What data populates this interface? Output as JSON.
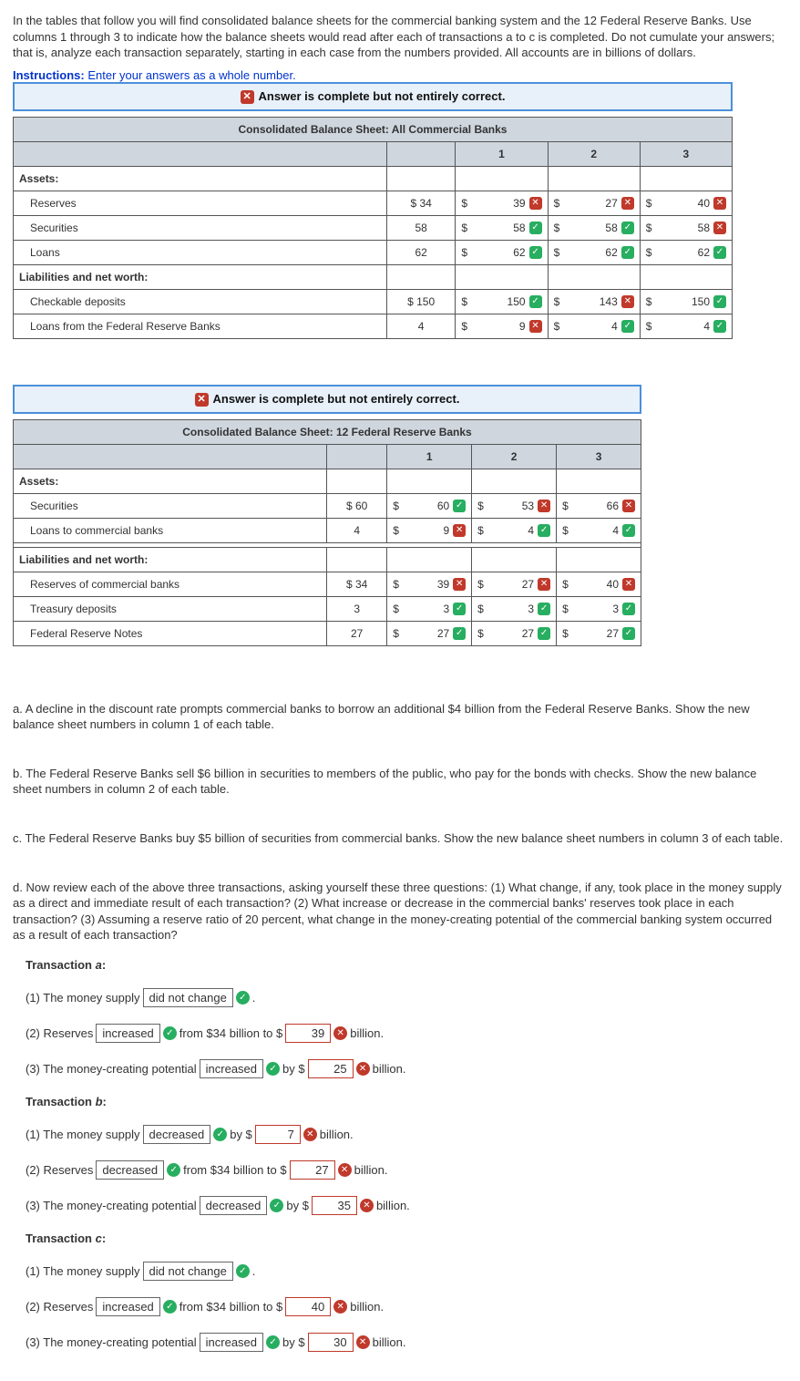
{
  "intro": "In the tables that follow you will find consolidated balance sheets for the commercial banking system and the 12 Federal Reserve Banks. Use columns 1 through 3 to indicate how the balance sheets would read after each of transactions a to c is completed. Do not cumulate your answers; that is, analyze each transaction separately, starting in each case from the numbers provided. All accounts are in billions of dollars.",
  "instructions_label": "Instructions:",
  "instructions_text": " Enter your answers as a whole number.",
  "banner_text": "Answer is complete but not entirely correct.",
  "col": {
    "c1": "1",
    "c2": "2",
    "c3": "3"
  },
  "t1": {
    "title": "Consolidated Balance Sheet: All Commercial Banks",
    "assets_label": "Assets:",
    "liab_label": "Liabilities and net worth:",
    "rows": {
      "reserves": {
        "label": "Reserves",
        "base": "$ 34",
        "c1": {
          "v": "39",
          "ok": false
        },
        "c2": {
          "v": "27",
          "ok": false
        },
        "c3": {
          "v": "40",
          "ok": false
        }
      },
      "securities": {
        "label": "Securities",
        "base": "58",
        "c1": {
          "v": "58",
          "ok": true
        },
        "c2": {
          "v": "58",
          "ok": true
        },
        "c3": {
          "v": "58",
          "ok": false
        }
      },
      "loans": {
        "label": "Loans",
        "base": "62",
        "c1": {
          "v": "62",
          "ok": true
        },
        "c2": {
          "v": "62",
          "ok": true
        },
        "c3": {
          "v": "62",
          "ok": true
        }
      },
      "deposits": {
        "label": "Checkable deposits",
        "base": "$ 150",
        "c1": {
          "v": "150",
          "ok": true
        },
        "c2": {
          "v": "143",
          "ok": false
        },
        "c3": {
          "v": "150",
          "ok": true
        }
      },
      "frb_loans": {
        "label": "Loans from the Federal Reserve Banks",
        "base": "4",
        "c1": {
          "v": "9",
          "ok": false
        },
        "c2": {
          "v": "4",
          "ok": true
        },
        "c3": {
          "v": "4",
          "ok": true
        }
      }
    }
  },
  "t2": {
    "title": "Consolidated Balance Sheet: 12 Federal Reserve Banks",
    "assets_label": "Assets:",
    "liab_label": "Liabilities and net worth:",
    "rows": {
      "securities": {
        "label": "Securities",
        "base": "$ 60",
        "c1": {
          "v": "60",
          "ok": true
        },
        "c2": {
          "v": "53",
          "ok": false
        },
        "c3": {
          "v": "66",
          "ok": false
        }
      },
      "loans_cb": {
        "label": "Loans to commercial banks",
        "base": "4",
        "c1": {
          "v": "9",
          "ok": false
        },
        "c2": {
          "v": "4",
          "ok": true
        },
        "c3": {
          "v": "4",
          "ok": true
        }
      },
      "reserves_cb": {
        "label": "Reserves of commercial banks",
        "base": "$ 34",
        "c1": {
          "v": "39",
          "ok": false
        },
        "c2": {
          "v": "27",
          "ok": false
        },
        "c3": {
          "v": "40",
          "ok": false
        }
      },
      "treasury": {
        "label": "Treasury deposits",
        "base": "3",
        "c1": {
          "v": "3",
          "ok": true
        },
        "c2": {
          "v": "3",
          "ok": true
        },
        "c3": {
          "v": "3",
          "ok": true
        }
      },
      "frn": {
        "label": "Federal Reserve Notes",
        "base": "27",
        "c1": {
          "v": "27",
          "ok": true
        },
        "c2": {
          "v": "27",
          "ok": true
        },
        "c3": {
          "v": "27",
          "ok": true
        }
      }
    }
  },
  "qa": "a. A decline in the discount rate prompts commercial banks to borrow an additional $4 billion from the Federal Reserve Banks. Show the new balance sheet numbers in column 1 of each table.",
  "qb": "b. The Federal Reserve Banks sell $6 billion in securities to members of the public, who pay for the bonds with checks. Show the new balance sheet numbers in column 2 of each table.",
  "qc": "c. The Federal Reserve Banks buy $5 billion of securities from commercial banks. Show the new balance sheet numbers in column 3 of each table.",
  "qd": "d. Now review each of the above three transactions, asking yourself these three questions: (1) What change, if any, took place in the money supply as a direct and immediate result of each transaction? (2) What increase or decrease in the commercial banks' reserves took place in each transaction? (3) Assuming a reserve ratio of 20 percent, what change in the money-creating potential of the commercial banking system occurred as a result of each transaction?",
  "ans": {
    "ta_label": "Transaction a:",
    "tb_label": "Transaction b:",
    "tc_label": "Transaction c:",
    "a1_pre": "(1) The money supply",
    "a1_sel": "did not change",
    "a2_pre": "(2) Reserves",
    "a2_sel": "increased",
    "a2_mid": " from $34 billion to $",
    "a2_val": "39",
    "a2_post": " billion.",
    "a3_pre": "(3) The money-creating potential",
    "a3_sel": "increased",
    "a3_mid": " by $",
    "a3_val": "25",
    "a3_post": " billion.",
    "b1_pre": "(1) The money supply",
    "b1_sel": "decreased",
    "b1_mid": " by $",
    "b1_val": "7",
    "b1_post": " billion.",
    "b2_pre": "(2) Reserves",
    "b2_sel": "decreased",
    "b2_mid": " from $34 billion to $",
    "b2_val": "27",
    "b2_post": " billion.",
    "b3_pre": "(3) The money-creating potential",
    "b3_sel": "decreased",
    "b3_mid": " by $",
    "b3_val": "35",
    "b3_post": " billion.",
    "c1_pre": "(1) The money supply",
    "c1_sel": "did not change",
    "c2_pre": "(2) Reserves",
    "c2_sel": "increased",
    "c2_mid": " from $34 billion to $",
    "c2_val": "40",
    "c2_post": " billion.",
    "c3_pre": "(3) The money-creating potential",
    "c3_sel": "increased",
    "c3_mid": " by $",
    "c3_val": "30",
    "c3_post": " billion.",
    "period": "."
  }
}
